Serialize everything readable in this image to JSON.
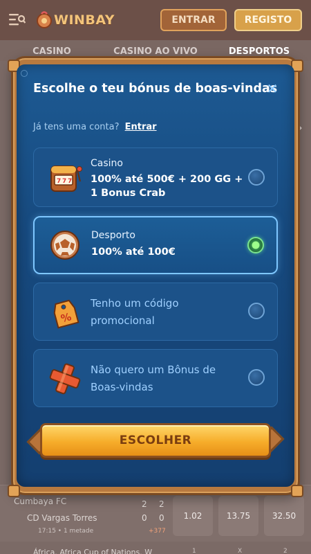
{
  "header": {
    "logo_text": "WINBAY",
    "login_label": "ENTRAR",
    "register_label": "REGISTO"
  },
  "background": {
    "tabs": [
      "CASINO",
      "CASINO AO VIVO",
      "DESPORTOS"
    ],
    "match": {
      "team1": "Cumbaya FC",
      "team2": "CD Vargas Torres",
      "score1": [
        "2",
        "2"
      ],
      "score2": [
        "0",
        "0"
      ],
      "time": "17:15 • 1 metade",
      "markets": "+377",
      "odds": [
        "1.02",
        "13.75",
        "32.50"
      ]
    },
    "next_row": "África. Africa Cup of Nations. W",
    "next_cols": [
      "1",
      "X",
      "2"
    ]
  },
  "modal": {
    "title": "Escolhe o teu bónus de boas-vindas",
    "account_prompt": "Já tens uma conta?",
    "account_link": "Entrar",
    "options": [
      {
        "title": "Casino",
        "desc": "100% até 500€ + 200 GG + 1 Bonus Crab",
        "icon": "slot-machine-icon",
        "selected": false
      },
      {
        "title": "Desporto",
        "desc": "100% até 100€",
        "icon": "football-icon",
        "selected": true
      },
      {
        "text": "Tenho um código promocional",
        "icon": "promo-tag-icon",
        "selected": false
      },
      {
        "text": "Não quero um Bônus de Boas-vindas",
        "icon": "no-bonus-cross-icon",
        "selected": false
      }
    ],
    "cta_label": "ESCOLHER"
  },
  "colors": {
    "modal_bg": "#1a5189",
    "frame": "#b87a3f",
    "selected_border": "#7ec7ff",
    "radio_on": "#7be58f",
    "cta": "#f6ad2a"
  }
}
